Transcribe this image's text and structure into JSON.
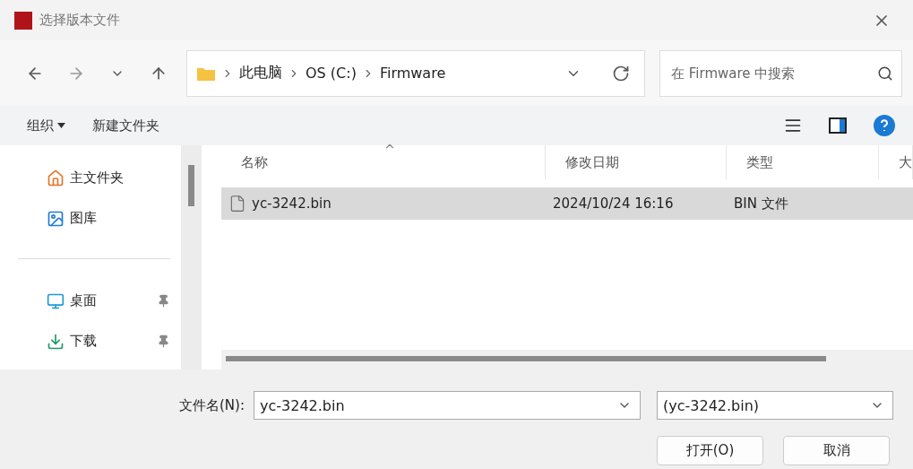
{
  "window": {
    "title": "选择版本文件"
  },
  "breadcrumb": [
    "此电脑",
    "OS (C:)",
    "Firmware"
  ],
  "search": {
    "placeholder": "在 Firmware 中搜索"
  },
  "commands": [
    {
      "label": "组织",
      "kind": "menu"
    },
    {
      "label": "新建文件夹",
      "kind": "plain"
    }
  ],
  "sidebar": {
    "items": [
      {
        "kind": "item",
        "label": "主文件夹",
        "pinned": false
      },
      {
        "kind": "item",
        "label": "图库",
        "pinned": false
      },
      {
        "kind": "divider"
      },
      {
        "kind": "item",
        "label": "桌面",
        "pinned": true
      },
      {
        "kind": "item",
        "label": "下载",
        "pinned": true
      }
    ]
  },
  "table": {
    "columns": [
      {
        "label": "名称",
        "sorted": true
      },
      {
        "label": "修改日期",
        "sorted": false
      },
      {
        "label": "类型",
        "sorted": false
      },
      {
        "label": "大",
        "sorted": false
      }
    ],
    "rows": [
      {
        "name": "yc-3242.bin",
        "modified": "2024/10/24 16:16",
        "type": "BIN 文件",
        "selected": true
      }
    ]
  },
  "filename": {
    "label": "文件名(N):",
    "value": "yc-3242.bin"
  },
  "filter": {
    "value": "(yc-3242.bin)"
  },
  "buttons": [
    "打开(O)",
    "取消"
  ]
}
